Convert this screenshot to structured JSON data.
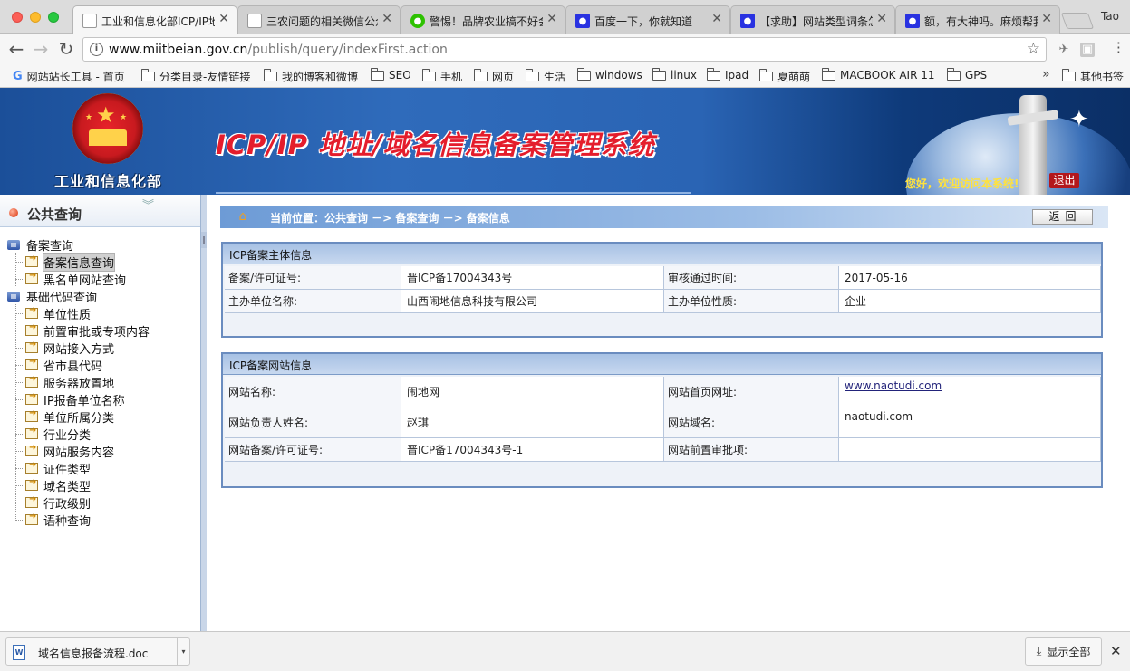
{
  "browser": {
    "tabs": [
      {
        "title": "工业和信息化部ICP/IP地",
        "favicon": "doc-icon",
        "active": true
      },
      {
        "title": "三农问题的相关微信公众",
        "favicon": "doc-icon",
        "active": false
      },
      {
        "title": "警惕！品牌农业搞不好会",
        "favicon": "wechat-icon",
        "active": false
      },
      {
        "title": "百度一下，你就知道",
        "favicon": "baidu-paw-icon",
        "active": false
      },
      {
        "title": "【求助】网站类型词条怎",
        "favicon": "baidu-paw-icon",
        "active": false
      },
      {
        "title": "额，有大神吗。麻烦帮我",
        "favicon": "baidu-paw-icon",
        "active": false
      }
    ],
    "profile_name": "Tao",
    "url_host": "www.miitbeian.gov.cn",
    "url_path": "/publish/query/indexFirst.action",
    "bookmarks": [
      {
        "label": "网站站长工具 - 首页",
        "icon": "google-icon"
      },
      {
        "label": "分类目录-友情链接",
        "icon": "folder-icon"
      },
      {
        "label": "我的博客和微博",
        "icon": "folder-icon"
      },
      {
        "label": "SEO",
        "icon": "folder-icon"
      },
      {
        "label": "手机",
        "icon": "folder-icon"
      },
      {
        "label": "网页",
        "icon": "folder-icon"
      },
      {
        "label": "生活",
        "icon": "folder-icon"
      },
      {
        "label": "windows",
        "icon": "folder-icon"
      },
      {
        "label": "linux",
        "icon": "folder-icon"
      },
      {
        "label": "Ipad",
        "icon": "folder-icon"
      },
      {
        "label": "夏萌萌",
        "icon": "folder-icon"
      },
      {
        "label": "MACBOOK AIR 11",
        "icon": "folder-icon"
      },
      {
        "label": "GPS",
        "icon": "folder-icon"
      }
    ],
    "bookmarks_more": "»",
    "other_bookmarks": "其他书签"
  },
  "banner": {
    "ministry": "工业和信息化部",
    "system_title": "ICP/IP 地址/域名信息备案管理系统",
    "welcome": "您好，欢迎访问本系统!",
    "logout": "退出"
  },
  "sidebar": {
    "title": "公共查询",
    "groups": [
      {
        "label": "备案查询",
        "items": [
          "备案信息查询",
          "黑名单网站查询"
        ]
      },
      {
        "label": "基础代码查询",
        "items": [
          "单位性质",
          "前置审批或专项内容",
          "网站接入方式",
          "省市县代码",
          "服务器放置地",
          "IP报备单位名称",
          "单位所属分类",
          "行业分类",
          "网站服务内容",
          "证件类型",
          "域名类型",
          "行政级别",
          "语种查询"
        ]
      }
    ],
    "selected_item": "备案信息查询"
  },
  "breadcrumb": {
    "text": "当前位置：公共查询  －>  备案查询  －>  备案信息",
    "back_button": "返回"
  },
  "subject_panel": {
    "title": "ICP备案主体信息",
    "rows": [
      {
        "label1": "备案/许可证号:",
        "value1": "晋ICP备17004343号",
        "label2": "审核通过时间:",
        "value2": "2017-05-16"
      },
      {
        "label1": "主办单位名称:",
        "value1": "山西闹地信息科技有限公司",
        "label2": "主办单位性质:",
        "value2": "企业"
      }
    ]
  },
  "website_panel": {
    "title": "ICP备案网站信息",
    "rows": [
      {
        "label1": "网站名称:",
        "value1": "闹地网",
        "label2": "网站首页网址:",
        "value2": "www.naotudi.com"
      },
      {
        "label1": "网站负责人姓名:",
        "value1": "赵琪",
        "label2": "网站域名:",
        "value2": "naotudi.com"
      },
      {
        "label1": "网站备案/许可证号:",
        "value1": "晋ICP备17004343号-1",
        "label2": "网站前置审批项:",
        "value2": ""
      }
    ]
  },
  "downloads": {
    "file_name": "域名信息报备流程.doc",
    "show_all": "显示全部"
  },
  "colors": {
    "banner_blue": "#2a64b4",
    "title_red": "#e41d2c",
    "welcome_yellow": "#ffe23d",
    "panel_border": "#6a8cbf",
    "link": "#22237a"
  }
}
